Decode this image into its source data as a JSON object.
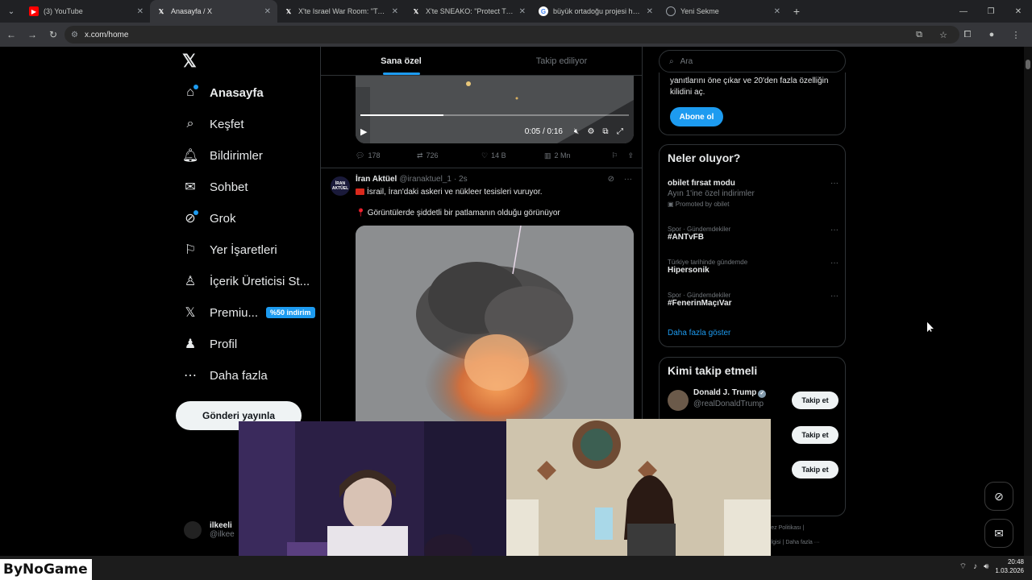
{
  "browser": {
    "tabs": [
      {
        "title": "(3) YouTube",
        "icon": "youtube-icon",
        "color": "#ff0000",
        "active": false
      },
      {
        "title": "Anasayfa / X",
        "icon": "x-icon",
        "color": "#ffffff",
        "active": true
      },
      {
        "title": "X'te Israel War Room: \"Turkey …",
        "icon": "x-icon",
        "color": "#ffffff",
        "active": false
      },
      {
        "title": "X'te SNEAKO: \"Protect Turkey a…",
        "icon": "x-icon",
        "color": "#ffffff",
        "active": false
      },
      {
        "title": "büyük ortadoğu projesi haritası…",
        "icon": "google-icon",
        "color": "#4285f4",
        "active": false
      },
      {
        "title": "Yeni Sekme",
        "icon": "chrome-icon",
        "color": "#9aa0a6",
        "active": false
      }
    ],
    "url": "x.com/home"
  },
  "leftnav": {
    "items": [
      {
        "label": "Anasayfa",
        "icon": "home-icon",
        "bold": true
      },
      {
        "label": "Keşfet",
        "icon": "search-icon"
      },
      {
        "label": "Bildirimler",
        "icon": "bell-icon"
      },
      {
        "label": "Sohbet",
        "icon": "mail-icon"
      },
      {
        "label": "Grok",
        "icon": "grok-icon"
      },
      {
        "label": "Yer İşaretleri",
        "icon": "bookmark-icon"
      },
      {
        "label": "İçerik Üreticisi St...",
        "icon": "creator-icon"
      },
      {
        "label": "Premiu...",
        "icon": "x-premium-icon",
        "badge": "%50 indirim"
      },
      {
        "label": "Profil",
        "icon": "profile-icon"
      },
      {
        "label": "Daha fazla",
        "icon": "more-icon"
      }
    ],
    "post_button": "Gönderi yayınla",
    "account_name": "ilkeeli",
    "account_handle": "@ilkee"
  },
  "timeline": {
    "tabs": [
      "Sana özel",
      "Takip ediliyor"
    ],
    "video": {
      "time": "0:05 / 0:16",
      "progress": 0.31
    },
    "actions": {
      "replies": "178",
      "reposts": "726",
      "likes": "14 B",
      "views": "2 Mn"
    },
    "tweet": {
      "name": "İran Aktüel",
      "handle": "@iranaktuel_1",
      "time": "· 2s",
      "avatar_text": "İRAN AKTÜEL",
      "text1": "İsrail, İran'daki askeri ve nükleer tesisleri vuruyor.",
      "text2": "Görüntülerde şiddetli bir patlamanın olduğu görünüyor"
    }
  },
  "rightcol": {
    "search_placeholder": "Ara",
    "premium_text": "yanıtlarını öne çıkar ve 20'den fazla özelliğin kilidini aç.",
    "subscribe": "Abone ol",
    "trends_title": "Neler oluyor?",
    "trends": [
      {
        "context": "",
        "name": "obilet fırsat modu",
        "sub": "Ayın 1'ine özel indirimler",
        "promo": "Promoted by obilet"
      },
      {
        "context": "Spor · Gündemdekiler",
        "name": "#ANTvFB"
      },
      {
        "context": "Türkiye tarihinde gündemde",
        "name": "Hipersonik"
      },
      {
        "context": "Spor · Gündemdekiler",
        "name": "#FenerinMaçıVar"
      }
    ],
    "show_more": "Daha fazla göster",
    "follow_title": "Kimi takip etmeli",
    "follow": [
      {
        "name": "Donald J. Trump",
        "handle": "@realDonaldTrump",
        "button": "Takip et"
      },
      {
        "name": "",
        "handle": "",
        "button": "Takip et"
      },
      {
        "name": "",
        "handle": "",
        "button": "Takip et"
      }
    ],
    "footer1": "Çerez Politikası  |",
    "footer2": "ilgisi  |   Daha fazla ···"
  },
  "overlay": {
    "logo": "ByNoGame"
  },
  "taskbar": {
    "time": "20:48",
    "date": "1.03.2026"
  }
}
